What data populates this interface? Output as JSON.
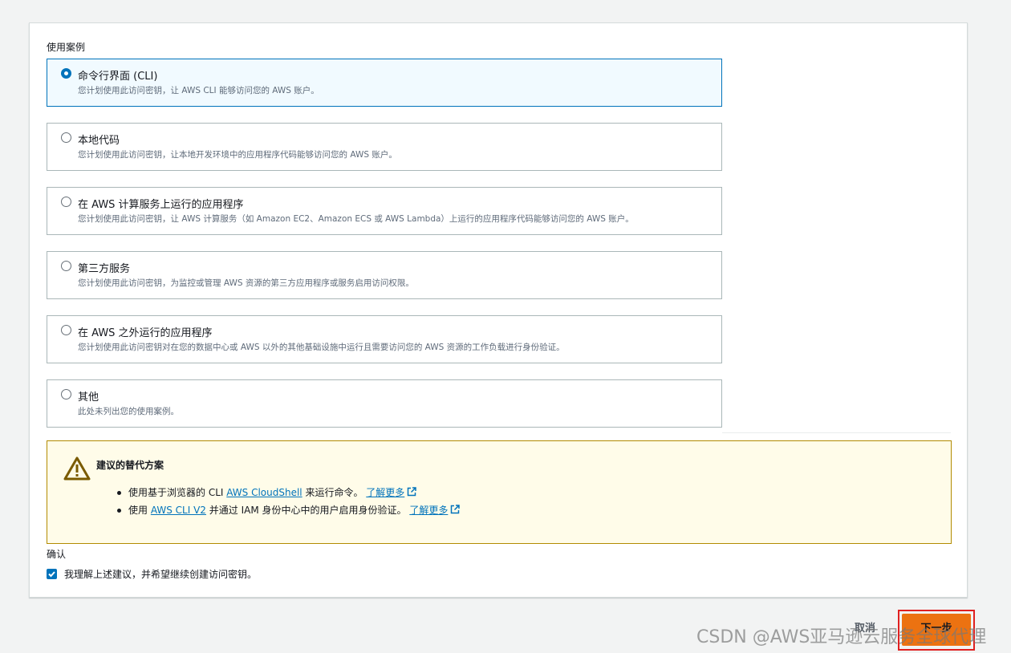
{
  "section_label": "使用案例",
  "options": [
    {
      "title": "命令行界面 (CLI)",
      "desc": "您计划使用此访问密钥，让 AWS CLI 能够访问您的 AWS 账户。",
      "selected": true
    },
    {
      "title": "本地代码",
      "desc": "您计划使用此访问密钥，让本地开发环境中的应用程序代码能够访问您的 AWS 账户。",
      "selected": false
    },
    {
      "title": "在 AWS 计算服务上运行的应用程序",
      "desc": "您计划使用此访问密钥，让 AWS 计算服务（如 Amazon EC2、Amazon ECS 或 AWS Lambda）上运行的应用程序代码能够访问您的 AWS 账户。",
      "selected": false
    },
    {
      "title": "第三方服务",
      "desc": "您计划使用此访问密钥，为监控或管理 AWS 资源的第三方应用程序或服务启用访问权限。",
      "selected": false
    },
    {
      "title": "在 AWS 之外运行的应用程序",
      "desc": "您计划使用此访问密钥对在您的数据中心或 AWS 以外的其他基础设施中运行且需要访问您的 AWS 资源的工作负载进行身份验证。",
      "selected": false
    },
    {
      "title": "其他",
      "desc": "此处未列出您的使用案例。",
      "selected": false
    }
  ],
  "alert": {
    "title": "建议的替代方案",
    "item1": {
      "pre": "使用基于浏览器的 CLI ",
      "link": "AWS CloudShell",
      "post": " 来运行命令。 ",
      "learn": "了解更多"
    },
    "item2": {
      "pre": "使用 ",
      "link": "AWS CLI V2",
      "post": " 并通过 IAM 身份中心中的用户启用身份验证。 ",
      "learn": "了解更多"
    }
  },
  "confirm": {
    "label": "确认",
    "checkbox_text": "我理解上述建议，并希望继续创建访问密钥。",
    "checked": true
  },
  "buttons": {
    "cancel": "取消",
    "next": "下一步"
  },
  "watermark": "CSDN @AWS亚马逊云服务全球代理",
  "colors": {
    "accent": "#0073bb",
    "primary_button": "#ec7211",
    "alert_bg": "#fffce9",
    "alert_border": "#b28b00",
    "highlight": "#e02020"
  }
}
